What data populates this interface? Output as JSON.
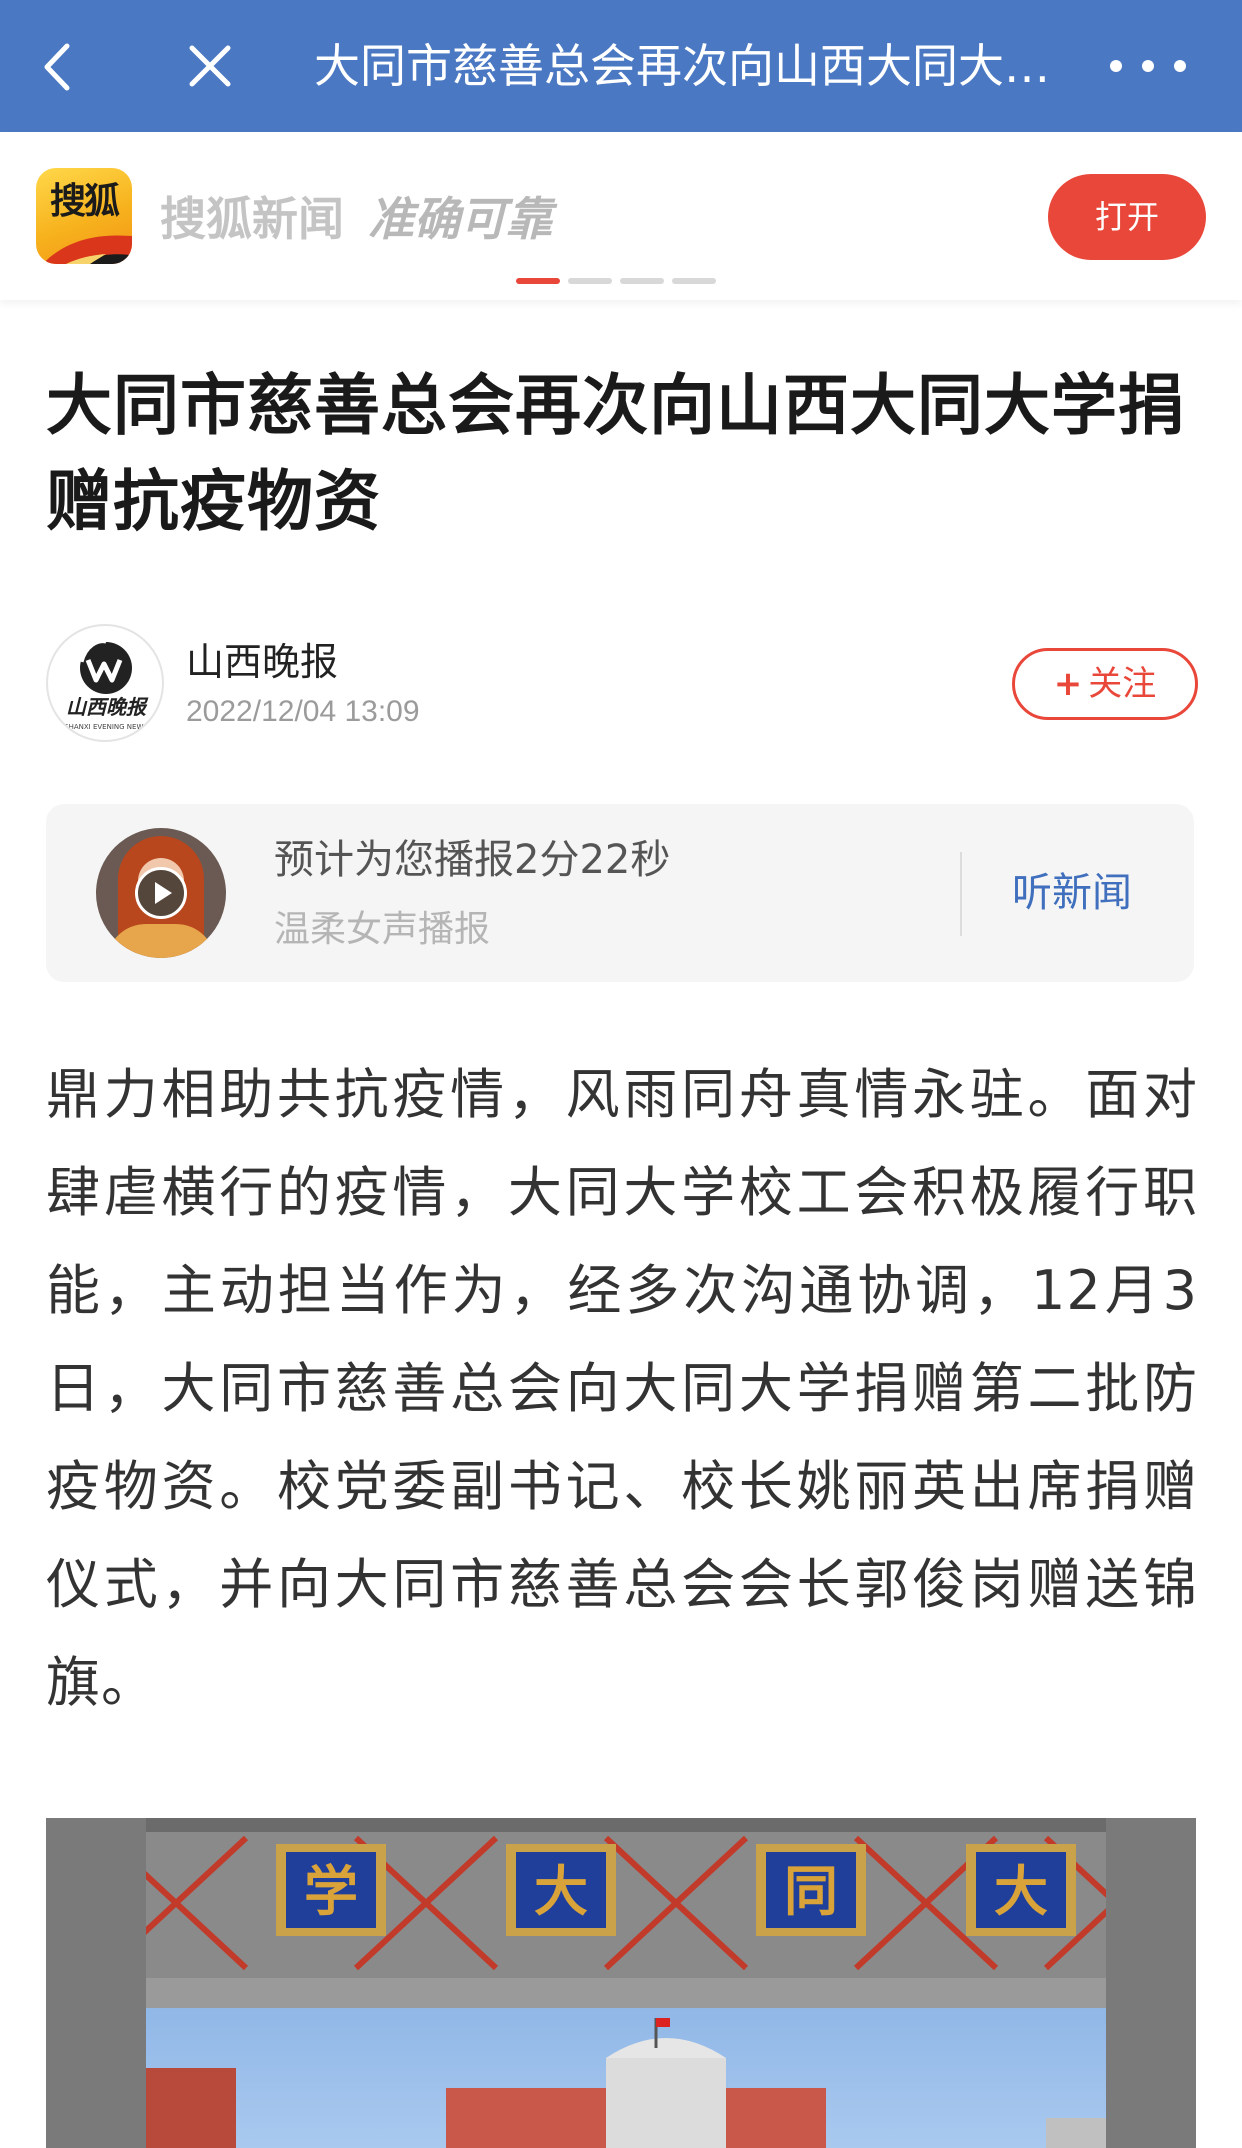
{
  "nav": {
    "title": "大同市慈善总会再次向山西大同大学捐赠抗疫物资",
    "back_icon": "chevron-left-icon",
    "close_icon": "close-icon",
    "more_icon": "more-icon",
    "bar_color": "#4a78c3"
  },
  "banner": {
    "logo_text": "搜狐",
    "slogan_name": "搜狐新闻",
    "slogan_tagline": "准确可靠",
    "open_label": "打开",
    "carousel_count": 4,
    "carousel_active_index": 0,
    "accent_color": "#e9473a"
  },
  "article": {
    "title": "大同市慈善总会再次向山西大同大学捐赠抗疫物资",
    "author": {
      "name": "山西晚报",
      "time": "2022/12/04 13:09",
      "follow_label": "关注",
      "follow_prefix": "+"
    },
    "audio": {
      "main_text": "预计为您播报2分22秒",
      "sub_text": "温柔女声播报",
      "action_label": "听新闻"
    },
    "body": "鼎力相助共抗疫情，风雨同舟真情永驻。面对肆虐横行的疫情，大同大学校工会积极履行职能，主动担当作为，经多次沟通协调，12月3日，大同市慈善总会向大同大学捐赠第二批防疫物资。校党委副书记、校长姚丽英出席捐赠仪式，并向大同市慈善总会会长郭俊岗赠送锦旗。",
    "image": {
      "gate_characters": [
        "学",
        "大",
        "同",
        "大"
      ]
    }
  }
}
